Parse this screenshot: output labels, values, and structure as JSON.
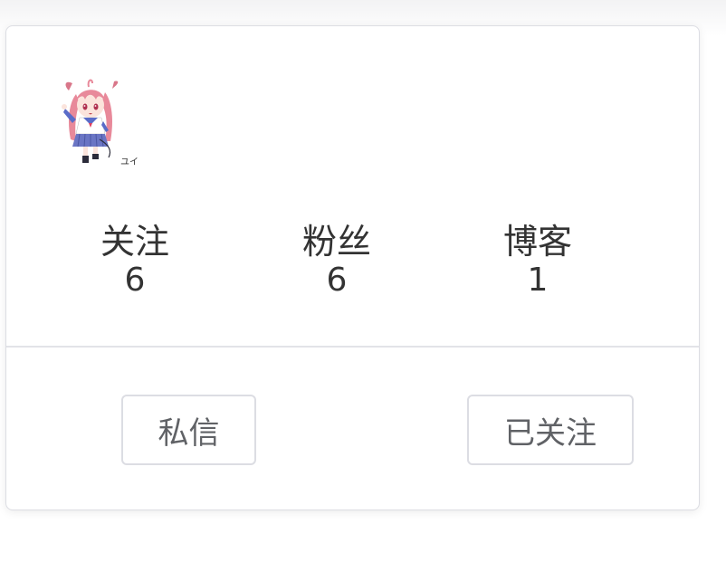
{
  "profile": {
    "avatar_icon": "anime-girl-avatar-icon",
    "avatar_caption": "ユイ"
  },
  "stats": [
    {
      "label": "关注",
      "value": "6"
    },
    {
      "label": "粉丝",
      "value": "6"
    },
    {
      "label": "博客",
      "value": "1"
    }
  ],
  "actions": {
    "message_label": "私信",
    "follow_label": "已关注"
  },
  "colors": {
    "border": "#dcdde3",
    "text": "#333333",
    "button_text": "#606266",
    "hair": "#e8899a",
    "skirt": "#6a75c4"
  }
}
